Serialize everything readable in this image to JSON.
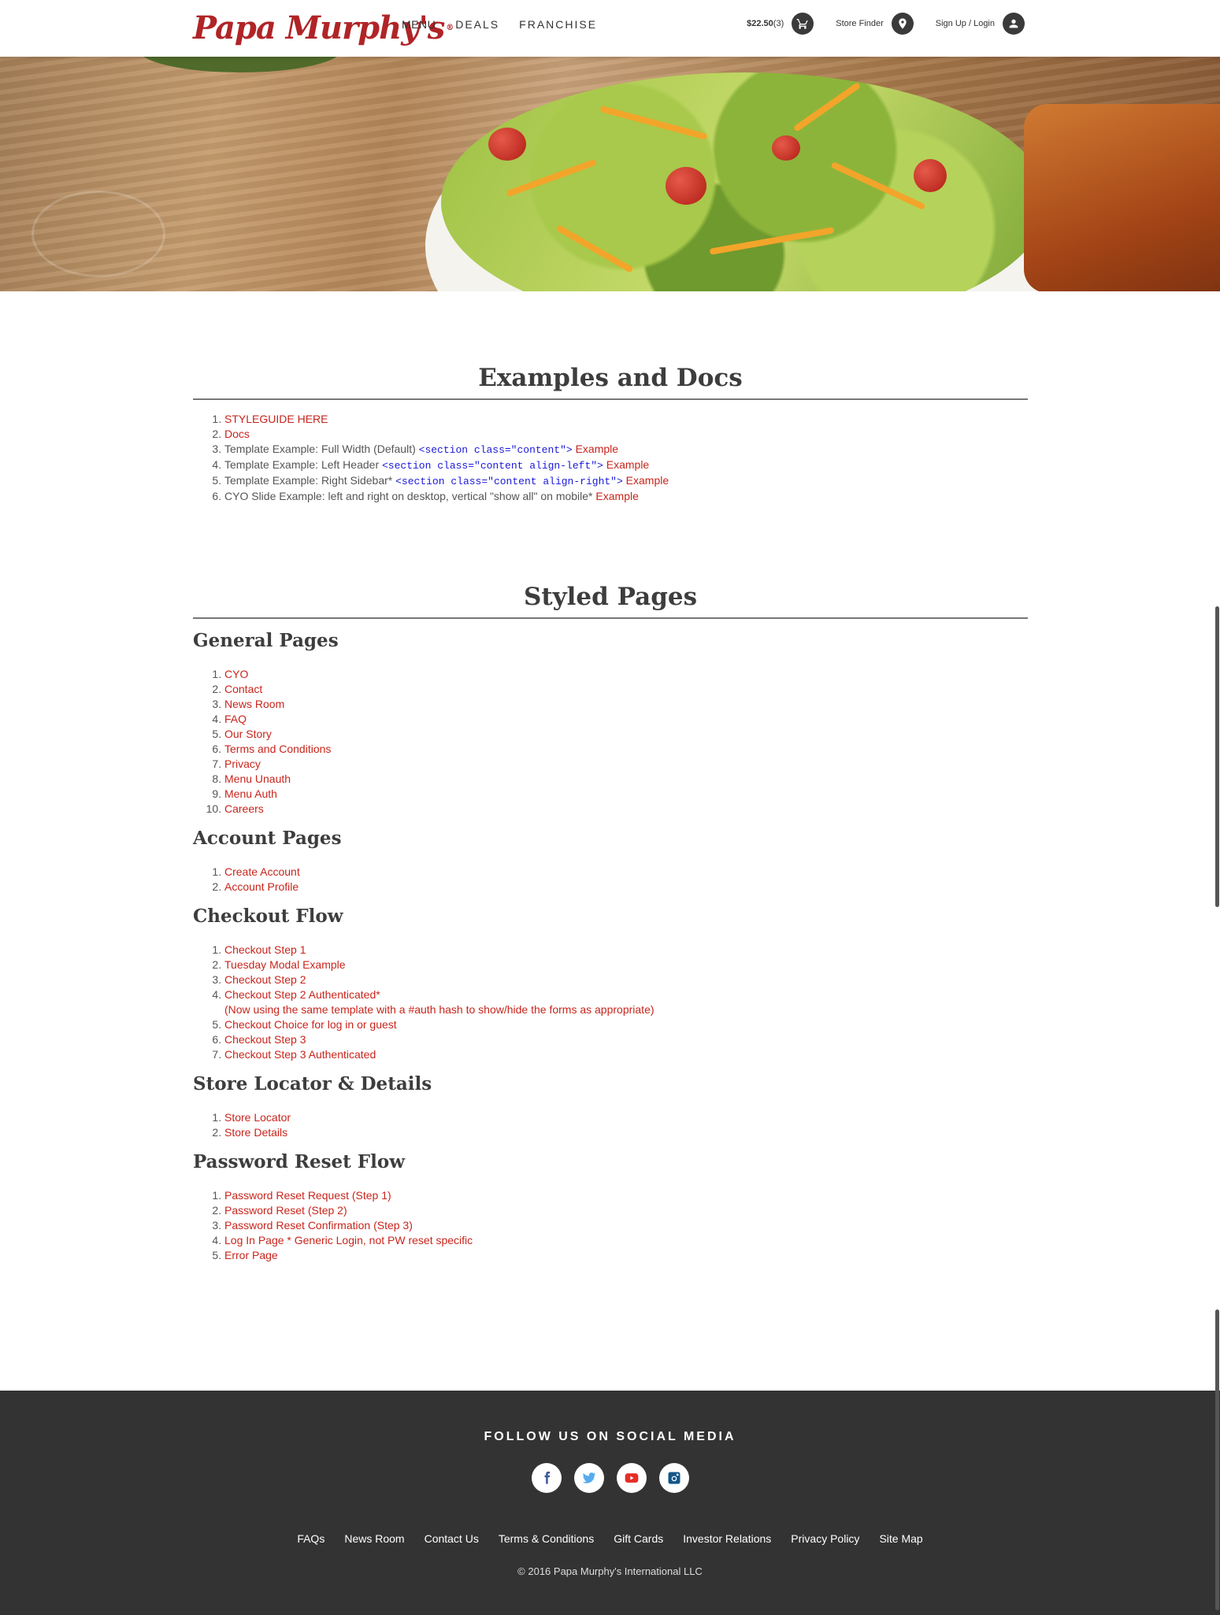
{
  "brand": {
    "logo_text": "Papa Murphy's",
    "reg_mark": "®",
    "accent_color": "#c8251c"
  },
  "nav": {
    "items": [
      "MENU",
      "DEALS",
      "FRANCHISE"
    ]
  },
  "utility": {
    "cart_price": "$22.50",
    "cart_count": "(3)",
    "cart_icon": "cart-icon",
    "store_finder_label": "Store Finder",
    "store_finder_icon": "location-pin-icon",
    "login_label": "Sign Up / Login",
    "login_icon": "user-icon"
  },
  "examples": {
    "title": "Examples and Docs",
    "items": [
      {
        "link": "STYLEGUIDE HERE"
      },
      {
        "link": "Docs"
      },
      {
        "text": "Template Example: Full Width (Default)",
        "code": "<section class=\"content\">",
        "link": "Example"
      },
      {
        "text": "Template Example: Left Header",
        "code": "<section class=\"content align-left\">",
        "link": "Example"
      },
      {
        "text": "Template Example: Right Sidebar*",
        "code": "<section class=\"content align-right\">",
        "link": "Example"
      },
      {
        "text": "CYO Slide Example: left and right on desktop, vertical \"show all\" on mobile*",
        "link": "Example"
      }
    ]
  },
  "styled": {
    "title": "Styled Pages",
    "groups": [
      {
        "heading": "General Pages",
        "links": [
          "CYO",
          "Contact",
          "News Room",
          "FAQ",
          "Our Story",
          "Terms and Conditions",
          "Privacy",
          "Menu Unauth",
          "Menu Auth",
          "Careers"
        ]
      },
      {
        "heading": "Account Pages",
        "links": [
          "Create Account",
          "Account Profile"
        ]
      },
      {
        "heading": "Checkout Flow",
        "links": [
          "Checkout Step 1",
          "Tuesday Modal Example",
          "Checkout Step 2",
          "Checkout Step 2 Authenticated*",
          "Checkout Choice for log in or guest",
          "Checkout Step 3",
          "Checkout Step 3 Authenticated"
        ],
        "note": "(Now using the same template with a #auth hash to show/hide the forms as appropriate)"
      },
      {
        "heading": "Store Locator & Details",
        "links": [
          "Store Locator",
          "Store Details"
        ]
      },
      {
        "heading": "Password Reset Flow",
        "links": [
          "Password Reset Request (Step 1)",
          "Password Reset (Step 2)",
          "Password Reset Confirmation (Step 3)",
          "Log In Page * Generic Login, not PW reset specific",
          "Error Page"
        ]
      }
    ]
  },
  "footer": {
    "follow": "FOLLOW US ON SOCIAL MEDIA",
    "social": [
      "facebook-icon",
      "twitter-icon",
      "youtube-icon",
      "instagram-icon"
    ],
    "links": [
      "FAQs",
      "News Room",
      "Contact Us",
      "Terms & Conditions",
      "Gift Cards",
      "Investor Relations",
      "Privacy Policy",
      "Site Map"
    ],
    "copyright": "© 2016 Papa Murphy's International LLC"
  }
}
